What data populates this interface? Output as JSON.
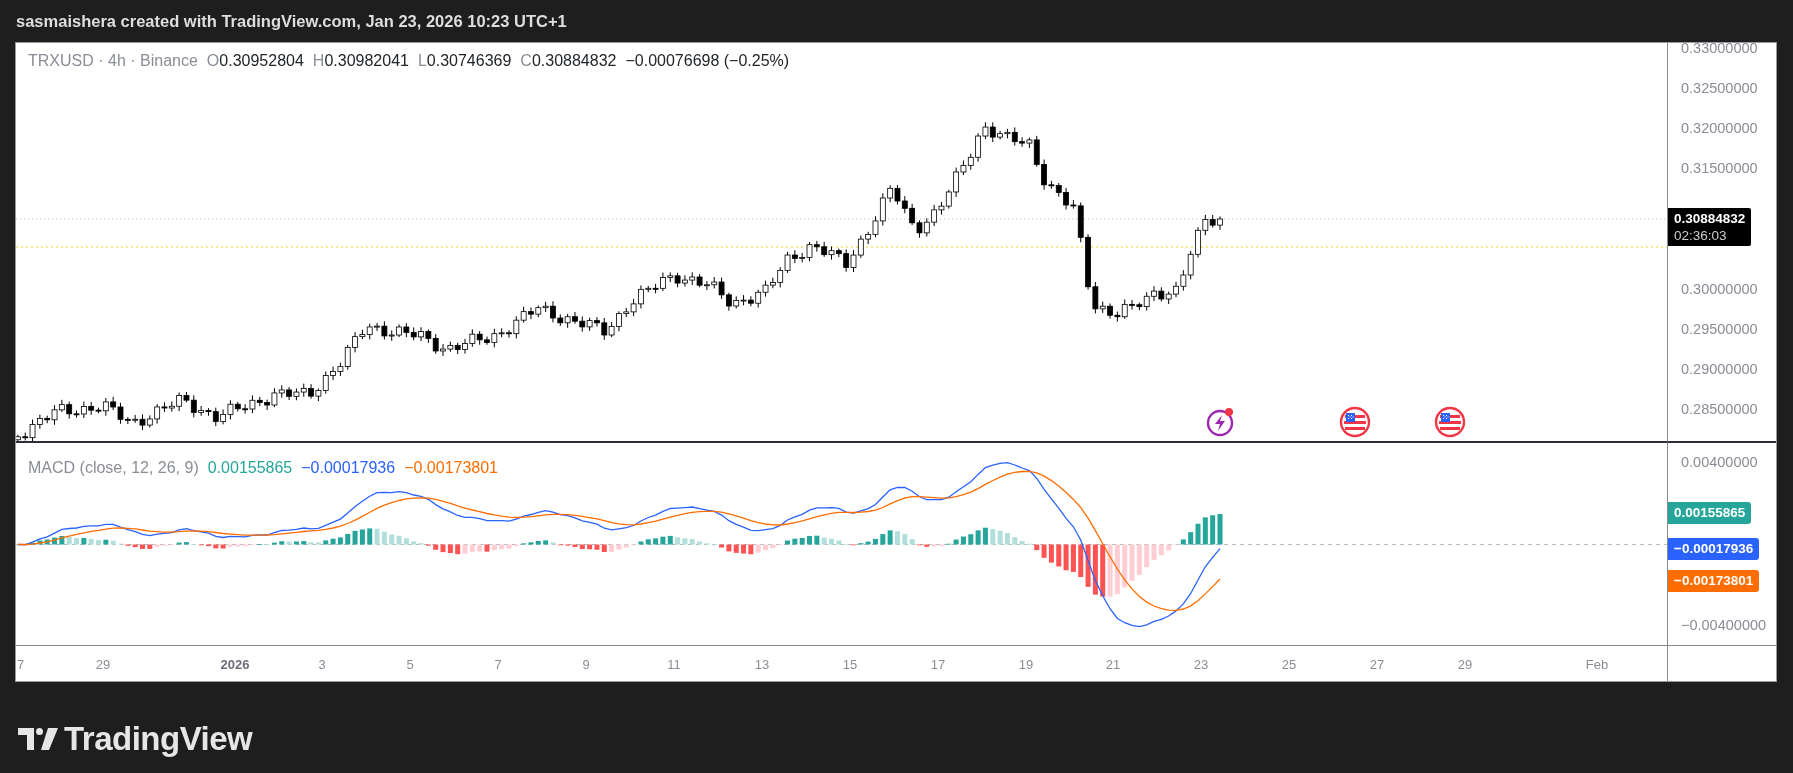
{
  "header": {
    "title": "sasmaishera created with TradingView.com, Jan 23, 2026 10:23 UTC+1"
  },
  "legend": {
    "symbol": "TRXUSD · 4h · Binance",
    "ohlc": [
      {
        "label": "O",
        "value": "0.30952804"
      },
      {
        "label": "H",
        "value": "0.30982041"
      },
      {
        "label": "L",
        "value": "0.30746369"
      },
      {
        "label": "C",
        "value": "0.30884832"
      }
    ],
    "change": "−0.00076698 (−0.25%)"
  },
  "price_axis": {
    "ticks": [
      "0.33000000",
      "0.32500000",
      "0.32000000",
      "0.31500000",
      "0.30000000",
      "0.29500000",
      "0.29000000",
      "0.28500000"
    ],
    "last_price": "0.30884832",
    "countdown": "02:36:03"
  },
  "events": [
    {
      "kind": "lightning"
    },
    {
      "kind": "flag"
    },
    {
      "kind": "flag"
    }
  ],
  "macd": {
    "title": "MACD (close, 12, 26, 9)",
    "values": [
      {
        "text": "0.00155865",
        "color": "#26a69a"
      },
      {
        "text": "−0.00017936",
        "color": "#2962ff"
      },
      {
        "text": "−0.00173801",
        "color": "#ff6d00"
      }
    ],
    "axis_ticks": [
      "0.00400000",
      "−0.00400000"
    ],
    "axis_labels": [
      {
        "text": "0.00155865",
        "color": "#26a69a"
      },
      {
        "text": "−0.00017936",
        "color": "#2962ff"
      },
      {
        "text": "−0.00173801",
        "color": "#ff6d00"
      }
    ]
  },
  "time_axis": [
    {
      "label": "7",
      "bold": false
    },
    {
      "label": "29",
      "bold": false
    },
    {
      "label": "2026",
      "bold": true
    },
    {
      "label": "3",
      "bold": false
    },
    {
      "label": "5",
      "bold": false
    },
    {
      "label": "7",
      "bold": false
    },
    {
      "label": "9",
      "bold": false
    },
    {
      "label": "11",
      "bold": false
    },
    {
      "label": "13",
      "bold": false
    },
    {
      "label": "15",
      "bold": false
    },
    {
      "label": "17",
      "bold": false
    },
    {
      "label": "19",
      "bold": false
    },
    {
      "label": "21",
      "bold": false
    },
    {
      "label": "23",
      "bold": false
    },
    {
      "label": "25",
      "bold": false
    },
    {
      "label": "27",
      "bold": false
    },
    {
      "label": "29",
      "bold": false
    },
    {
      "label": "Feb",
      "bold": false
    }
  ],
  "footer": {
    "logo": "TradingView"
  }
}
